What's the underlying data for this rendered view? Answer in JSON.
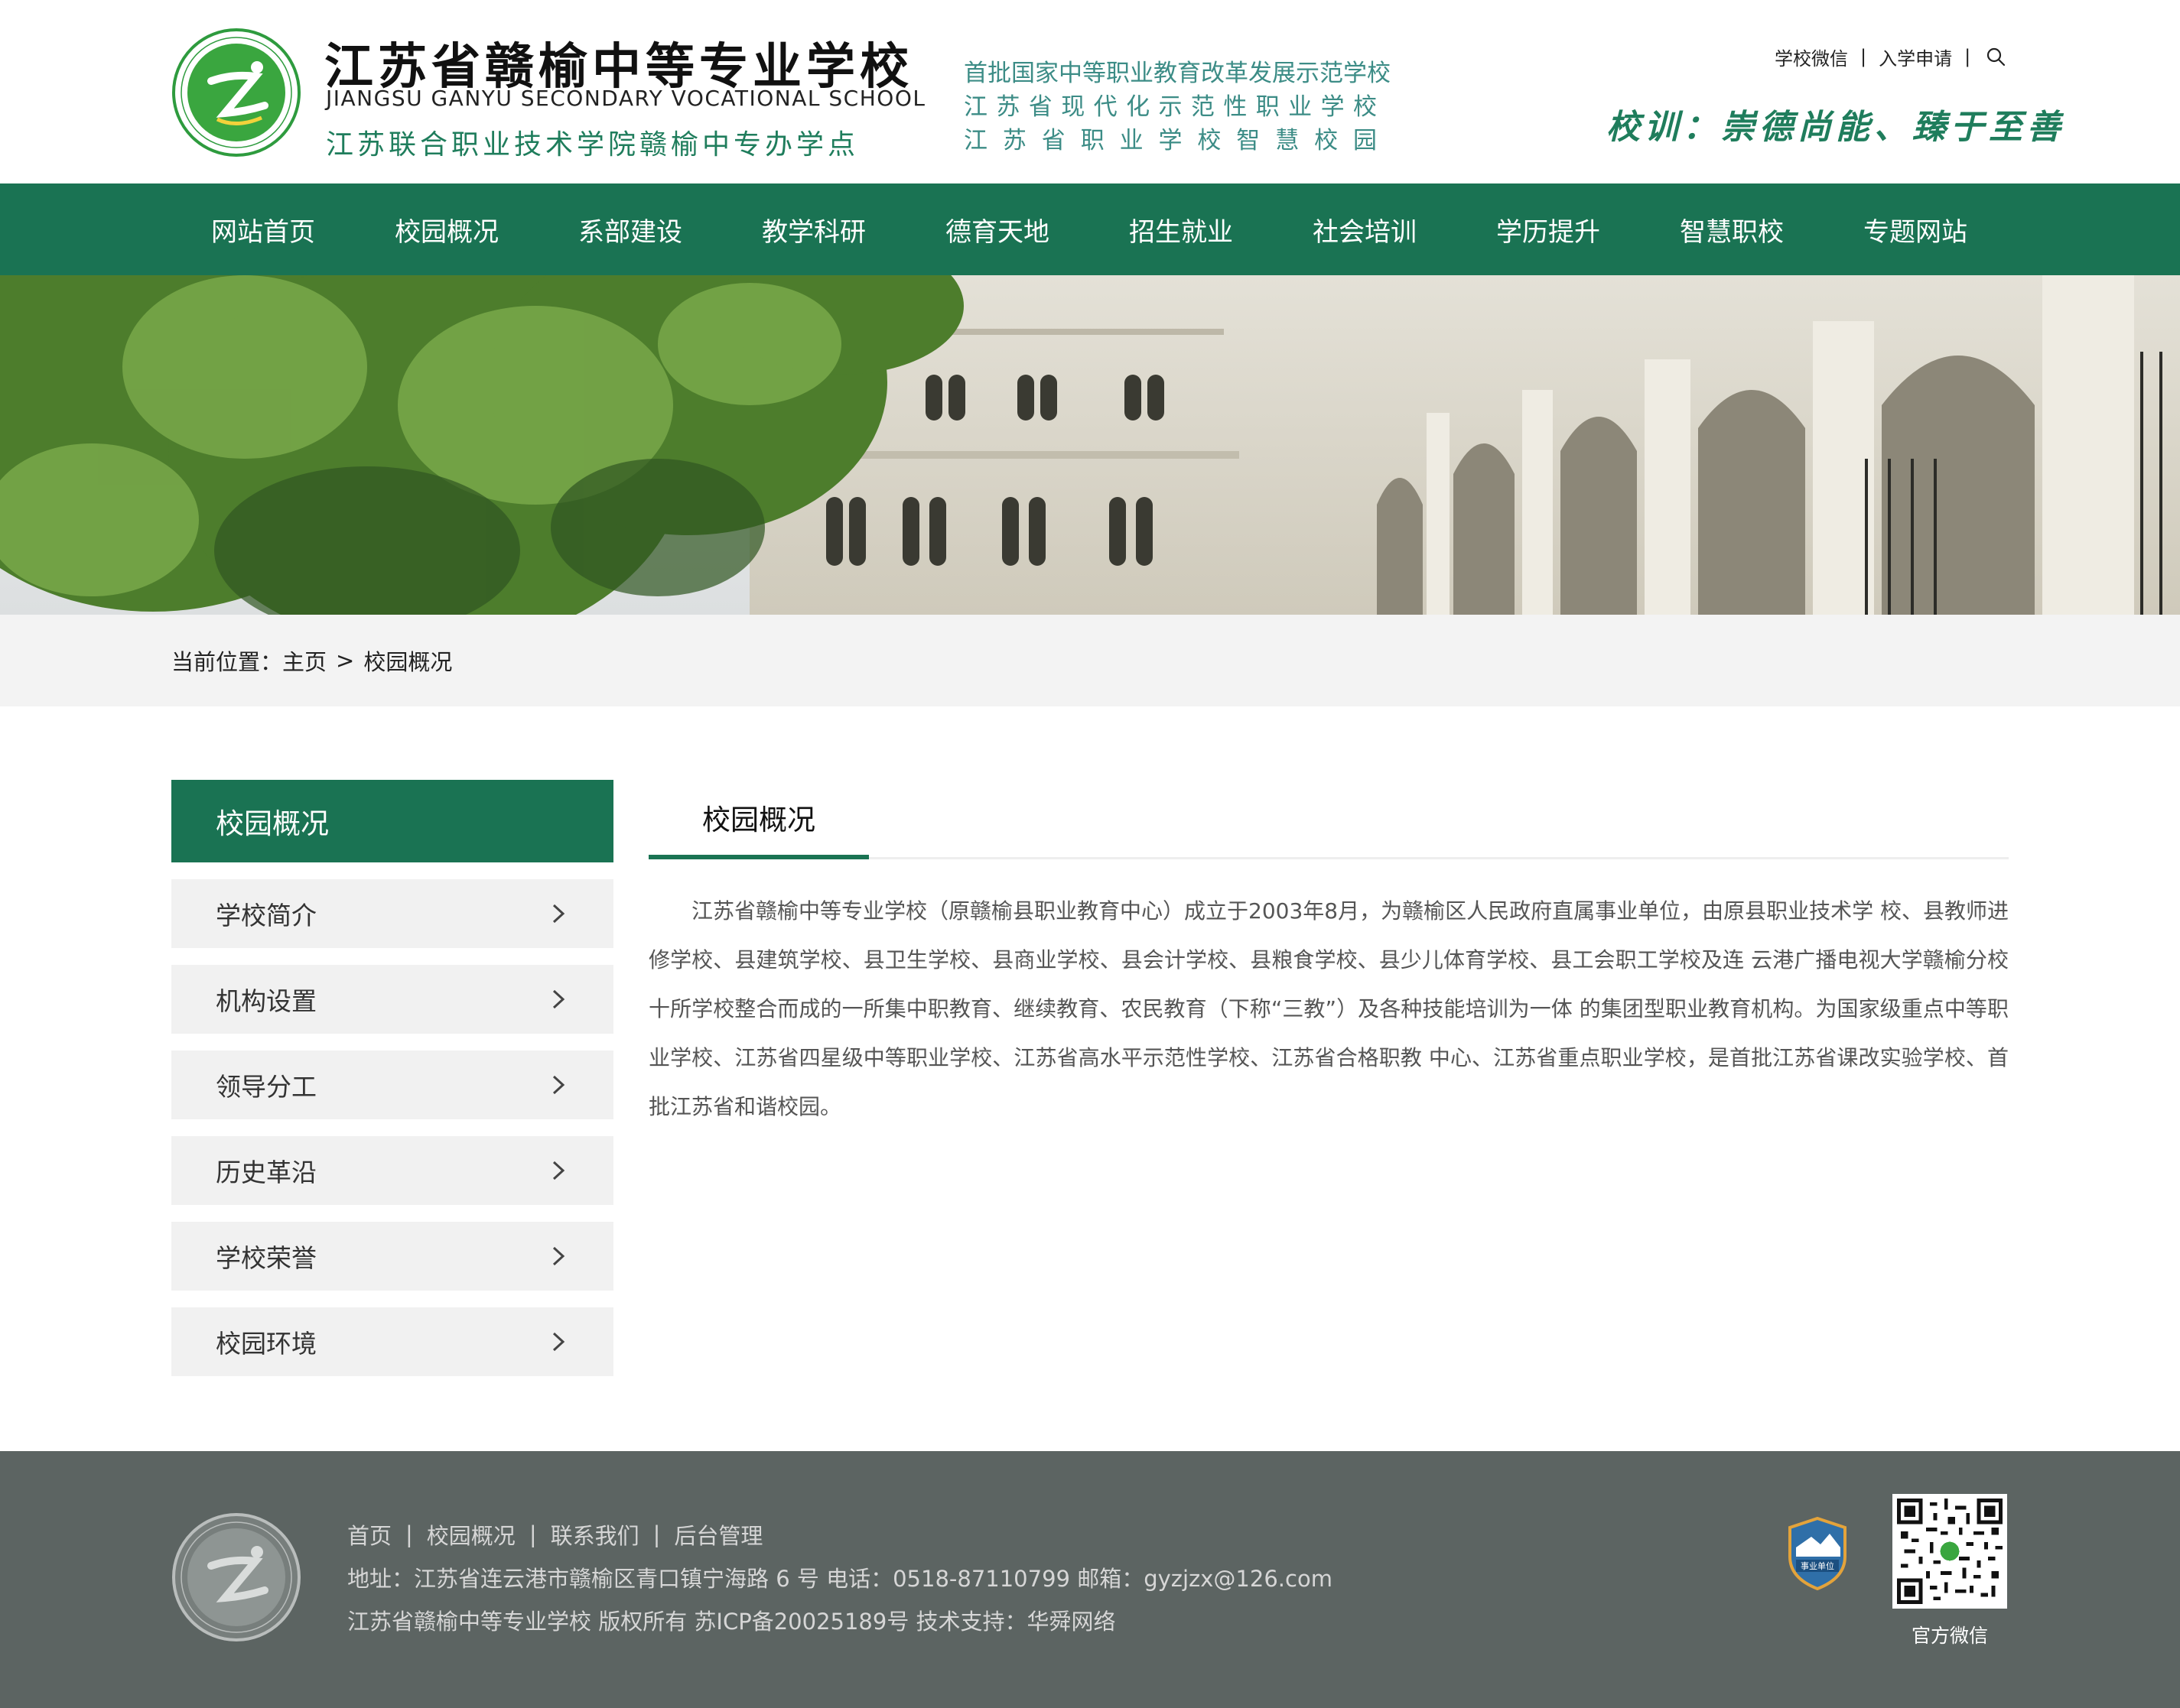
{
  "header": {
    "school_name_cn": "江苏省赣榆中等专业学校",
    "school_name_en": "JIANGSU GANYU SECONDARY VOCATIONAL SCHOOL",
    "school_branch": "江苏联合职业技术学院赣榆中专办学点",
    "honors": [
      "首批国家中等职业教育改革发展示范学校",
      "江苏省现代化示范性职业学校",
      "江苏省职业学校智慧校园"
    ],
    "motto": "校训：崇德尚能、臻于至善",
    "top_links": [
      "学校微信",
      "入学申请"
    ],
    "search_icon": "search-icon"
  },
  "nav": {
    "items": [
      "网站首页",
      "校园概况",
      "系部建设",
      "教学科研",
      "德育天地",
      "招生就业",
      "社会培训",
      "学历提升",
      "智慧职校",
      "专题网站"
    ]
  },
  "breadcrumb": {
    "prefix": "当前位置：",
    "home": "主页",
    "arrow": ">",
    "current": "校园概况"
  },
  "sidebar": {
    "title": "校园概况",
    "items": [
      "学校简介",
      "机构设置",
      "领导分工",
      "历史革沿",
      "学校荣誉",
      "校园环境"
    ],
    "chevron_icon": "chevron-right-icon"
  },
  "content": {
    "tab": "校园概况",
    "paragraph": "江苏省赣榆中等专业学校（原赣榆县职业教育中心）成立于2003年8月，为赣榆区人民政府直属事业单位，由原县职业技术学 校、县教师进修学校、县建筑学校、县卫生学校、县商业学校、县会计学校、县粮食学校、县少儿体育学校、县工会职工学校及连 云港广播电视大学赣榆分校十所学校整合而成的一所集中职教育、继续教育、农民教育（下称“三教”）及各种技能培训为一体 的集团型职业教育机构。为国家级重点中等职业学校、江苏省四星级中等职业学校、江苏省高水平示范性学校、江苏省合格职教 中心、江苏省重点职业学校，是首批江苏省课改实验学校、首批江苏省和谐校园。"
  },
  "footer": {
    "links": [
      "首页",
      "校园概况",
      "联系我们",
      "后台管理"
    ],
    "address": "地址：江苏省连云港市赣榆区青口镇宁海路 6 号 电话：0518-87110799 邮箱：gyzjzx@126.com",
    "copyright": "江苏省赣榆中等专业学校 版权所有 苏ICP备20025189号 技术支持：华舜网络",
    "badge_text": "事业单位",
    "qr_label": "官方微信"
  },
  "colors": {
    "brand_green": "#1a7353",
    "honor_teal": "#3c8c86",
    "footer_bg": "#5c6462",
    "crumb_bg": "#f3f3f3",
    "side_item_bg": "#f1f1f1"
  }
}
